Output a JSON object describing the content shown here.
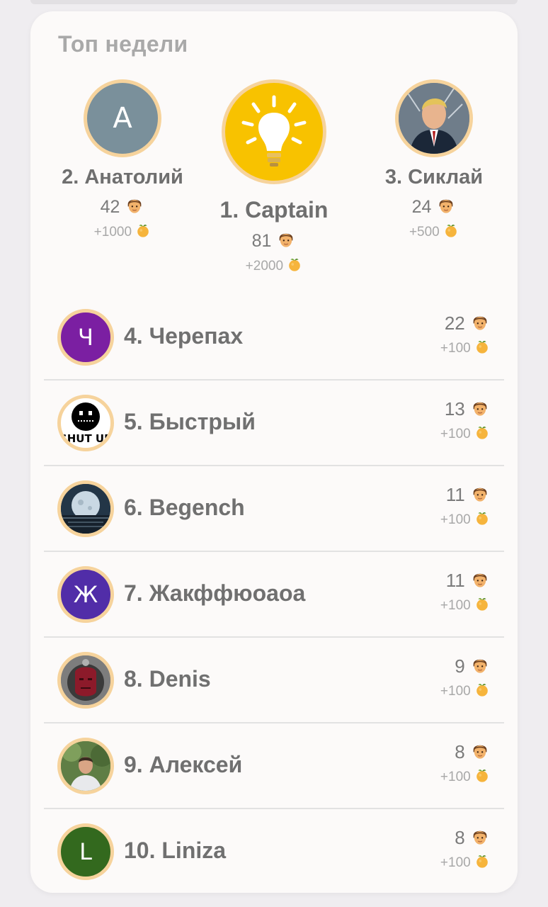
{
  "card": {
    "title": "Топ недели"
  },
  "podium": [
    {
      "rank_name": "1. Captain",
      "score": "81",
      "bonus": "+2000",
      "avatar_type": "lightbulb-image",
      "avatar_bg": "#f8c200"
    },
    {
      "rank_name": "2. Анатолий",
      "score": "42",
      "bonus": "+1000",
      "avatar_type": "letter",
      "avatar_letter": "A",
      "avatar_bg": "#7a909b"
    },
    {
      "rank_name": "3. Сиклай",
      "score": "24",
      "bonus": "+500",
      "avatar_type": "photo",
      "avatar_bg": "#7f8a95"
    }
  ],
  "list": [
    {
      "rank_name": "4. Черепах",
      "score": "22",
      "bonus": "+100",
      "avatar_type": "letter",
      "avatar_letter": "Ч",
      "avatar_bg": "#7b1fa2"
    },
    {
      "rank_name": "5. Быстрый",
      "score": "13",
      "bonus": "+100",
      "avatar_type": "shut-up-image",
      "avatar_text": "SHUT UP",
      "avatar_bg": "#ffffff"
    },
    {
      "rank_name": "6. Begench",
      "score": "11",
      "bonus": "+100",
      "avatar_type": "moon-photo",
      "avatar_bg": "#3d5566"
    },
    {
      "rank_name": "7. Жакффюоаоа",
      "score": "11",
      "bonus": "+100",
      "avatar_type": "letter",
      "avatar_letter": "Ж",
      "avatar_bg": "#512da8"
    },
    {
      "rank_name": "8. Denis",
      "score": "9",
      "bonus": "+100",
      "avatar_type": "mask-image",
      "avatar_bg": "#8a8a8a"
    },
    {
      "rank_name": "9. Алексей",
      "score": "8",
      "bonus": "+100",
      "avatar_type": "person-photo",
      "avatar_bg": "#6d8a4f"
    },
    {
      "rank_name": "10. Liniza",
      "score": "8",
      "bonus": "+100",
      "avatar_type": "letter",
      "avatar_letter": "L",
      "avatar_bg": "#33691e"
    }
  ],
  "icons": {
    "score_icon": "man-emoji-icon",
    "bonus_icon": "tangerine-icon"
  },
  "colors": {
    "avatar_ring": "#f6d39c",
    "card_bg": "#fcfaf9"
  }
}
